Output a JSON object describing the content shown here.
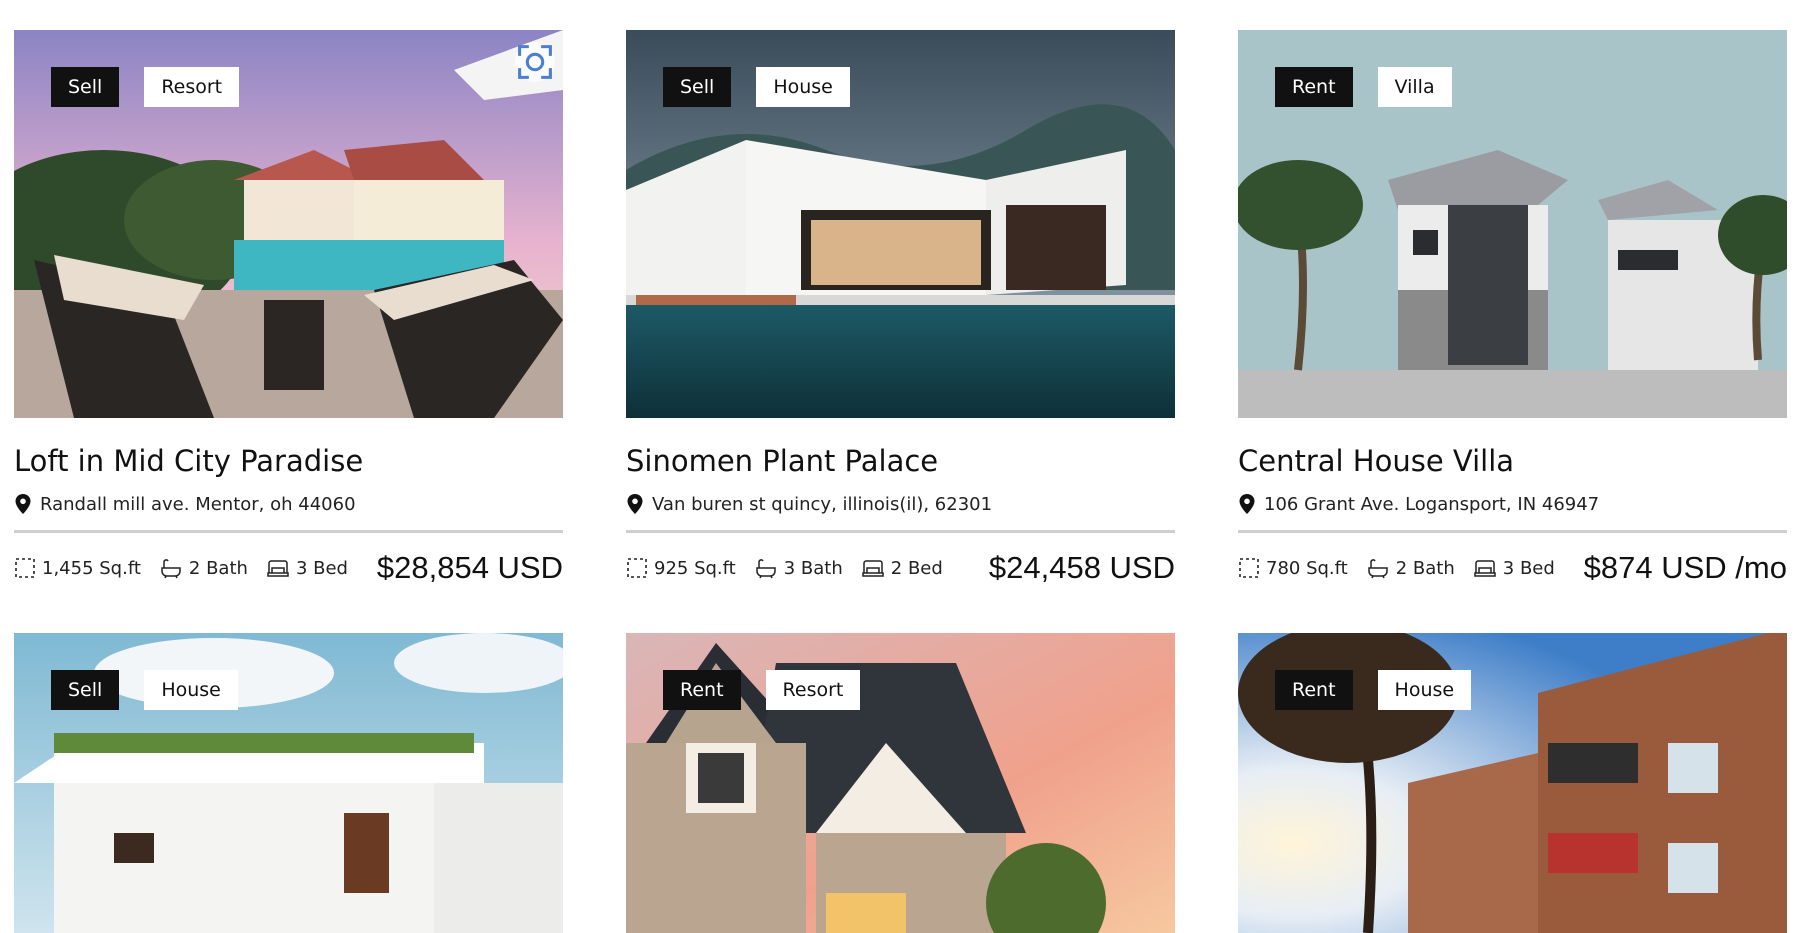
{
  "listings": [
    {
      "status": "Sell",
      "type": "Resort",
      "title": "Loft in Mid City Paradise",
      "address": "Randall mill ave. Mentor, oh 44060",
      "area": "1,455 Sq.ft",
      "bath": "2 Bath",
      "bed": "3 Bed",
      "price": "$28,854 USD",
      "image": "resort-pool-photo"
    },
    {
      "status": "Sell",
      "type": "House",
      "title": "Sinomen Plant Palace",
      "address": "Van buren st quincy, illinois(il), 62301",
      "area": "925 Sq.ft",
      "bath": "3 Bath",
      "bed": "2 Bed",
      "price": "$24,458 USD",
      "image": "modern-house-pool-photo"
    },
    {
      "status": "Rent",
      "type": "Villa",
      "title": "Central House Villa",
      "address": "106 Grant Ave. Logansport, IN 46947",
      "area": "780 Sq.ft",
      "bath": "2 Bath",
      "bed": "3 Bed",
      "price": "$874 USD /mo",
      "image": "villa-palm-photo"
    },
    {
      "status": "Sell",
      "type": "House",
      "image": "white-house-plants-photo"
    },
    {
      "status": "Rent",
      "type": "Resort",
      "image": "gable-house-sunset-photo"
    },
    {
      "status": "Rent",
      "type": "House",
      "image": "brick-apartment-photo"
    }
  ],
  "icons": {
    "lens": "visual-search-icon",
    "pin": "map-pin-icon",
    "area": "area-icon",
    "bath": "bathtub-icon",
    "bed": "bed-icon"
  }
}
